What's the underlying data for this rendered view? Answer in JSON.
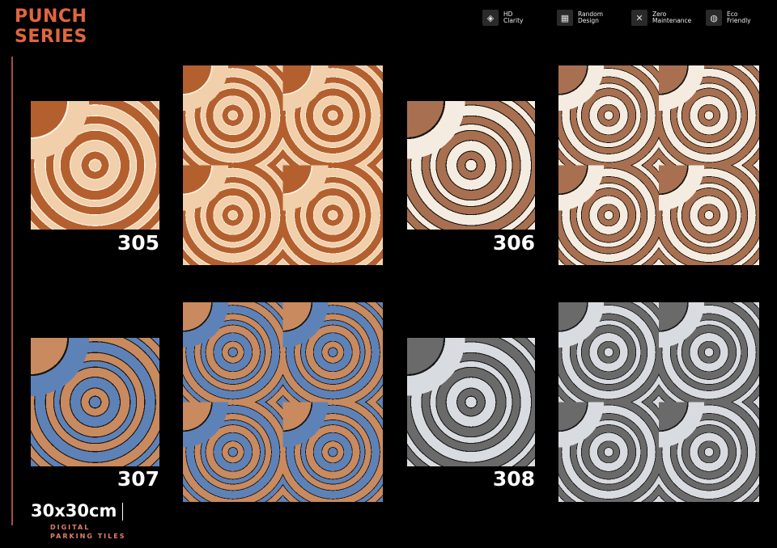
{
  "header": {
    "title_line1": "PUNCH",
    "title_line2": "SERIES"
  },
  "features": [
    {
      "icon": "hd-clarity-icon",
      "line1": "HD",
      "line2": "Clarity"
    },
    {
      "icon": "random-design-icon",
      "line1": "Random",
      "line2": "Design"
    },
    {
      "icon": "zero-maintenance-icon",
      "line1": "Zero",
      "line2": "Maintenance"
    },
    {
      "icon": "eco-friendly-icon",
      "line1": "Eco",
      "line2": "Friendly"
    }
  ],
  "tiles": [
    {
      "code": "305",
      "colors": {
        "dark": "#b4602e",
        "light": "#f0cfaa",
        "grout": "#fbefe0"
      }
    },
    {
      "code": "306",
      "colors": {
        "dark": "#a87050",
        "light": "#f4ece0",
        "grout": "#1a1410"
      }
    },
    {
      "code": "307",
      "colors": {
        "dark": "#c88a5e",
        "light": "#5d82b8",
        "grout": "#1a1410"
      }
    },
    {
      "code": "308",
      "colors": {
        "dark": "#6a6a6a",
        "light": "#d8dbe0",
        "grout": "#1a1a1a"
      }
    }
  ],
  "footer": {
    "size": "30x30cm",
    "line1": "DIGITAL",
    "line2": "PARKING TILES"
  }
}
